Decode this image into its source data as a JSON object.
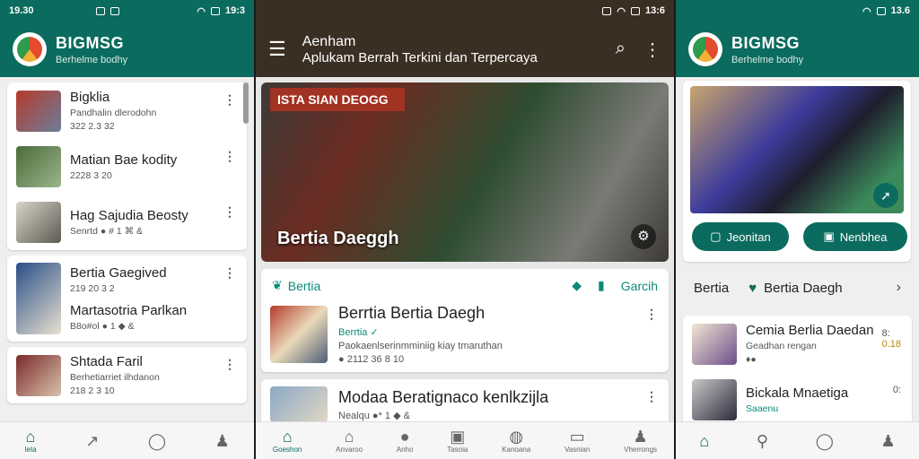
{
  "colors": {
    "brand_green": "#0b6b5e",
    "header_brown": "#3b2e23",
    "accent_teal": "#0b8a7a"
  },
  "screen1": {
    "status_time": "19.30",
    "status_right": "19:3",
    "brand": "BIGMSG",
    "brand_sub": "Berhelme bodhy",
    "items": [
      {
        "title": "Bigklia",
        "meta1": "Pandhalin dlerodohn",
        "meta2": "322 2.3 32"
      },
      {
        "title": "Matian Bae kodity",
        "meta1": "2228 3 20",
        "meta2": ""
      },
      {
        "title": "Hag Sajudia Beosty",
        "meta1": "Senrtd ● # 1 ⌘ &",
        "meta2": ""
      },
      {
        "title": "Bertia Gaegived",
        "meta1": "219 20 3 2",
        "meta2": ""
      },
      {
        "title": "Martasotria Parlkan",
        "meta1": "B8o#ol ● 1 ◆ &",
        "meta2": ""
      },
      {
        "title": "Shtada Faril",
        "meta1": "Berhetiarriet ilhdanon",
        "meta2": "218 2 3 10"
      }
    ],
    "nav": [
      {
        "icon": "home-icon",
        "glyph": "⌂",
        "label": "Ieta"
      },
      {
        "icon": "trend-icon",
        "glyph": "↗",
        "label": ""
      },
      {
        "icon": "chat-icon",
        "glyph": "◯",
        "label": ""
      },
      {
        "icon": "person-icon",
        "glyph": "♟",
        "label": ""
      }
    ]
  },
  "screen2": {
    "status_right": "13:6",
    "title": "Aenham",
    "subtitle": "Aplukam Berrah Terkini dan Terpercaya",
    "hero_banner": "ISTA SIAN DEOGG",
    "hero_caption": "Bertia Daeggh",
    "feed_head_left": "Bertia",
    "feed_head_right": "Garcih",
    "feed": [
      {
        "title": "Berrtia Bertia Daegh",
        "source": "Berrtia ✓",
        "meta": "Paokaenlserinmminiig kiay tmaruthan",
        "date": "● 2112 36 8 10"
      },
      {
        "title": "Modaa Beratignaco kenlkzijla",
        "source": "",
        "meta": "Nealqu ●* 1 ◆ &",
        "date": ""
      }
    ],
    "nav": [
      {
        "icon": "home-icon",
        "glyph": "⌂",
        "label": "Goeshon"
      },
      {
        "icon": "building-icon",
        "glyph": "⌂",
        "label": "Anvaroo"
      },
      {
        "icon": "circle-icon",
        "glyph": "●",
        "label": "Anho"
      },
      {
        "icon": "box-icon",
        "glyph": "▣",
        "label": "Tasoia"
      },
      {
        "icon": "lock-icon",
        "glyph": "◍",
        "label": "Kanoana"
      },
      {
        "icon": "screen-icon",
        "glyph": "▭",
        "label": "Vasnian"
      },
      {
        "icon": "person-icon",
        "glyph": "♟",
        "label": "Vherrongs"
      }
    ]
  },
  "screen3": {
    "status_right": "13.6",
    "brand": "BIGMSG",
    "brand_sub": "Berhelme bodhy",
    "btn1": "Jeonitan",
    "btn2": "Nenbhea",
    "tab1": "Bertia",
    "tab2": "Bertia Daegh",
    "items": [
      {
        "title": "Cemia Berlia Daedan",
        "meta1": "Geadhan rengan",
        "meta2": "♦●",
        "side": "8:",
        "side2": "0.18"
      },
      {
        "title": "Bickala Mnaetiga",
        "meta1": "Saaenu",
        "meta2": "",
        "side": "0:",
        "side2": ""
      }
    ],
    "nav": [
      {
        "icon": "home-icon",
        "glyph": "⌂"
      },
      {
        "icon": "pin-icon",
        "glyph": "⚲"
      },
      {
        "icon": "chat-icon",
        "glyph": "◯"
      },
      {
        "icon": "person-icon",
        "glyph": "♟"
      }
    ]
  }
}
